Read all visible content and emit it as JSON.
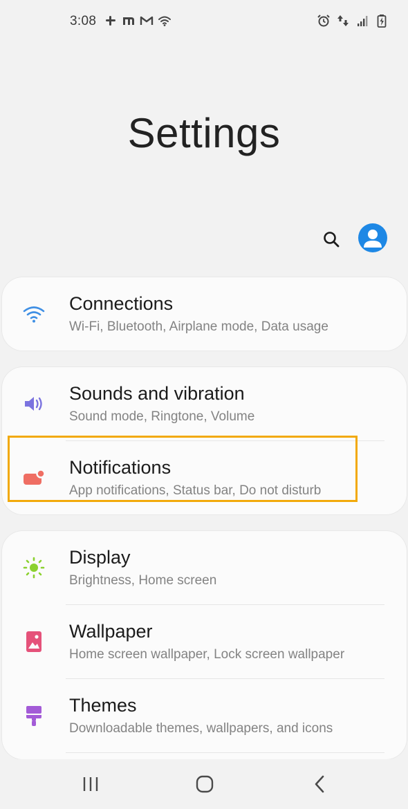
{
  "status_bar": {
    "time": "3:08",
    "left_icons": [
      "slack-icon",
      "m-app-icon",
      "gmail-icon",
      "wifi-icon"
    ],
    "right_icons": [
      "alarm-icon",
      "data-transfer-icon",
      "signal-icon",
      "battery-icon"
    ]
  },
  "header": {
    "title": "Settings"
  },
  "toolbar": {
    "icons": [
      "search-icon",
      "account-avatar-icon"
    ]
  },
  "groups": [
    {
      "items": [
        {
          "title": "Connections",
          "subtitle": "Wi-Fi, Bluetooth, Airplane mode, Data usage",
          "icon": "wifi-icon",
          "icon_color": "#3f8fe4"
        }
      ]
    },
    {
      "items": [
        {
          "title": "Sounds and vibration",
          "subtitle": "Sound mode, Ringtone, Volume",
          "icon": "volume-icon",
          "icon_color": "#7b73df"
        },
        {
          "title": "Notifications",
          "subtitle": "App notifications, Status bar, Do not disturb",
          "icon": "notification-icon",
          "icon_color": "#ef6e63",
          "highlighted": true
        }
      ]
    },
    {
      "items": [
        {
          "title": "Display",
          "subtitle": "Brightness, Home screen",
          "icon": "brightness-icon",
          "icon_color": "#8bd12f"
        },
        {
          "title": "Wallpaper",
          "subtitle": "Home screen wallpaper, Lock screen wallpaper",
          "icon": "wallpaper-icon",
          "icon_color": "#e5527a"
        },
        {
          "title": "Themes",
          "subtitle": "Downloadable themes, wallpapers, and icons",
          "icon": "themes-icon",
          "icon_color": "#a35bd7"
        }
      ]
    }
  ],
  "nav_bar": {
    "buttons": [
      "recent-apps-icon",
      "home-icon",
      "back-icon"
    ]
  },
  "colors": {
    "background": "#f2f2f2",
    "card": "#fbfbfb",
    "highlight_border": "#f2a90a",
    "avatar": "#1e88e5"
  }
}
